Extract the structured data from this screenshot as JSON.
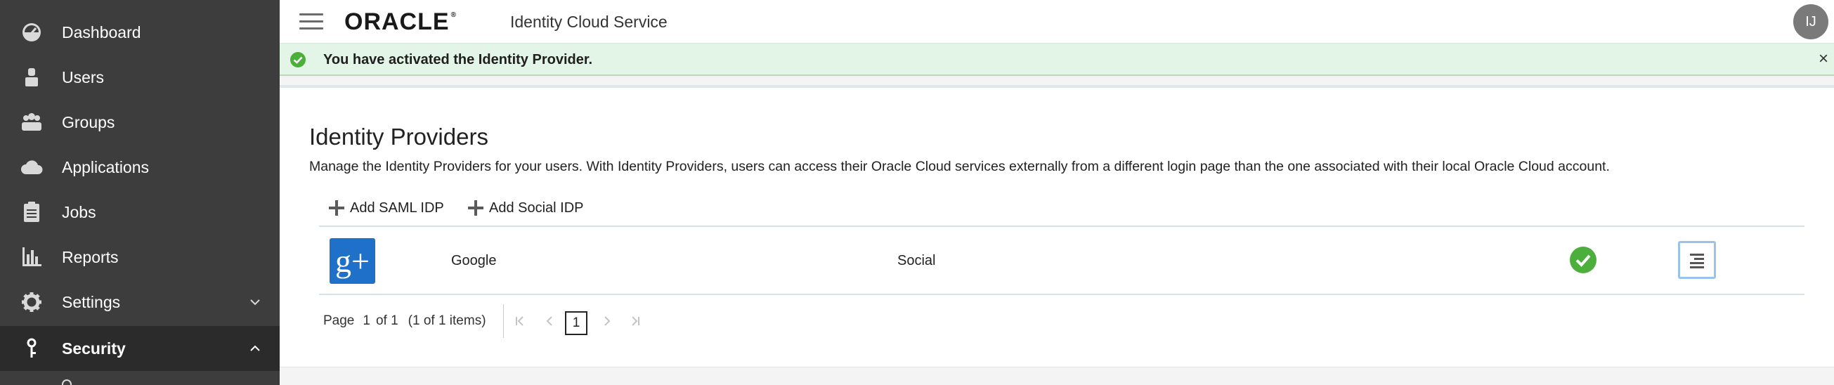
{
  "sidebar": {
    "items": [
      {
        "label": "Dashboard",
        "icon": "dashboard-icon"
      },
      {
        "label": "Users",
        "icon": "user-icon"
      },
      {
        "label": "Groups",
        "icon": "groups-icon"
      },
      {
        "label": "Applications",
        "icon": "cloud-icon"
      },
      {
        "label": "Jobs",
        "icon": "clipboard-icon"
      },
      {
        "label": "Reports",
        "icon": "bar-chart-icon"
      },
      {
        "label": "Settings",
        "icon": "gear-icon"
      },
      {
        "label": "Security",
        "icon": "key-icon"
      }
    ]
  },
  "header": {
    "logo_text": "ORACLE",
    "service_name": "Identity Cloud Service",
    "avatar_initials": "IJ"
  },
  "banner": {
    "message": "You have activated the Identity Provider.",
    "close_symbol": "×",
    "color": "#e3f5e6"
  },
  "main": {
    "title": "Identity Providers",
    "description": "Manage the Identity Providers for your users. With Identity Providers, users can access their Oracle Cloud services externally from a different login page than the one associated with their local Oracle Cloud account.",
    "toolbar": {
      "add_saml_label": "Add SAML IDP",
      "add_social_label": "Add Social IDP"
    },
    "providers": [
      {
        "logo": "g+",
        "name": "Google",
        "type": "Social",
        "status": "active"
      }
    ],
    "pagination": {
      "page_label": "Page",
      "current": "1",
      "of_label": "of 1",
      "items_label": "(1 of 1 items)",
      "current_button": "1"
    }
  },
  "colors": {
    "sidebar_bg": "#3d3d3d",
    "active_bg": "#2b2b2b",
    "success_green": "#4caf3b",
    "google_blue": "#1e70c9"
  }
}
